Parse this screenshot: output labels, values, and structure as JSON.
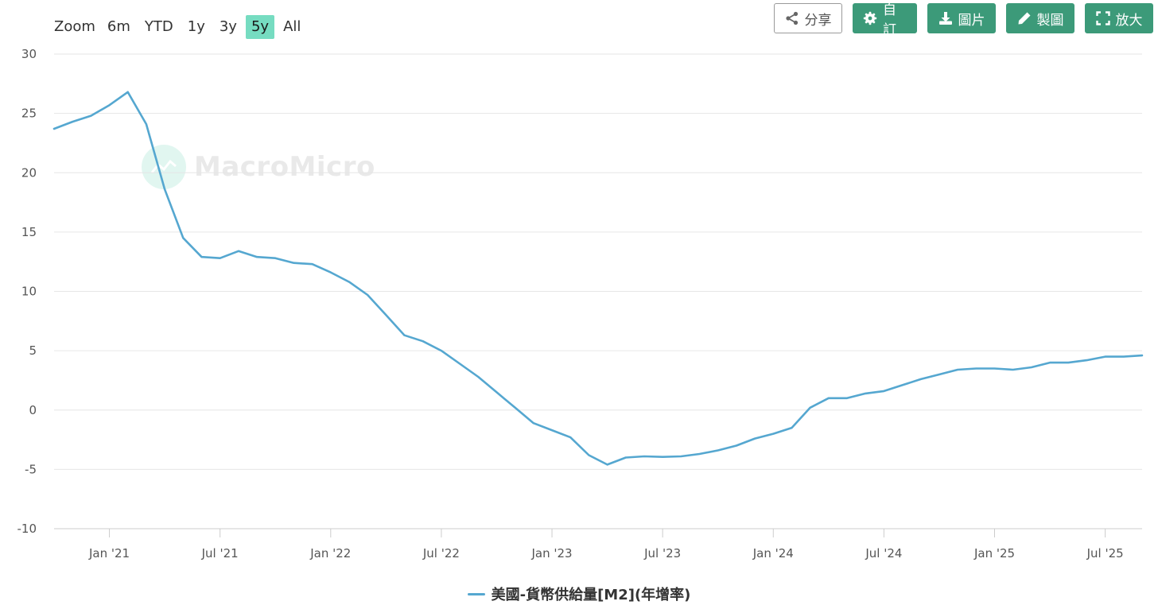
{
  "zoom": {
    "label": "Zoom",
    "options": [
      "6m",
      "YTD",
      "1y",
      "3y",
      "5y",
      "All"
    ],
    "active": "5y"
  },
  "toolbar": {
    "share": "分享",
    "customize": "自訂",
    "download": "圖片",
    "edit": "製圖",
    "fullscreen": "放大"
  },
  "watermark": "MacroMicro",
  "colors": {
    "line": "#55a7d0",
    "grid": "#e6e6e6",
    "accent": "#3c9a79",
    "zoom_active": "#76dcc1"
  },
  "legend": {
    "label": "美國-貨幣供給量[M2](年增率)"
  },
  "chart_data": {
    "type": "line",
    "title": "",
    "xlabel": "",
    "ylabel": "",
    "ylim": [
      -10,
      30
    ],
    "yticks": [
      30,
      25,
      20,
      15,
      10,
      5,
      0,
      -5,
      -10
    ],
    "xticks": [
      "Jan '21",
      "Jul '21",
      "Jan '22",
      "Jul '22",
      "Jan '23",
      "Jul '23",
      "Jan '24",
      "Jul '24",
      "Jan '25",
      "Jul '25"
    ],
    "grid": true,
    "legend_position": "bottom-center",
    "series": [
      {
        "name": "美國-貨幣供給量[M2](年增率)",
        "x": [
          "2020-10",
          "2020-11",
          "2020-12",
          "2021-01",
          "2021-02",
          "2021-03",
          "2021-04",
          "2021-05",
          "2021-06",
          "2021-07",
          "2021-08",
          "2021-09",
          "2021-10",
          "2021-11",
          "2021-12",
          "2022-01",
          "2022-02",
          "2022-03",
          "2022-04",
          "2022-05",
          "2022-06",
          "2022-07",
          "2022-08",
          "2022-09",
          "2022-10",
          "2022-11",
          "2022-12",
          "2023-01",
          "2023-02",
          "2023-03",
          "2023-04",
          "2023-05",
          "2023-06",
          "2023-07",
          "2023-08",
          "2023-09",
          "2023-10",
          "2023-11",
          "2023-12",
          "2024-01",
          "2024-02",
          "2024-03",
          "2024-04",
          "2024-05",
          "2024-06",
          "2024-07",
          "2024-08",
          "2024-09",
          "2024-10",
          "2024-11",
          "2024-12",
          "2025-01",
          "2025-02",
          "2025-03",
          "2025-04",
          "2025-05",
          "2025-06",
          "2025-07",
          "2025-08",
          "2025-09"
        ],
        "values": [
          23.7,
          24.3,
          24.8,
          25.7,
          26.8,
          24.1,
          18.6,
          14.5,
          12.9,
          12.8,
          13.4,
          12.9,
          12.8,
          12.4,
          12.3,
          11.6,
          10.8,
          9.7,
          8.0,
          6.3,
          5.8,
          5.0,
          3.9,
          2.8,
          1.5,
          0.2,
          -1.1,
          -1.7,
          -2.3,
          -3.8,
          -4.6,
          -4.0,
          -3.9,
          -3.95,
          -3.9,
          -3.7,
          -3.4,
          -3.0,
          -2.4,
          -2.0,
          -1.5,
          0.2,
          1.0,
          1.0,
          1.4,
          1.6,
          2.1,
          2.6,
          3.0,
          3.4,
          3.5,
          3.5,
          3.4,
          3.6,
          4.0,
          4.0,
          4.2,
          4.5,
          4.5,
          4.6
        ]
      }
    ]
  }
}
